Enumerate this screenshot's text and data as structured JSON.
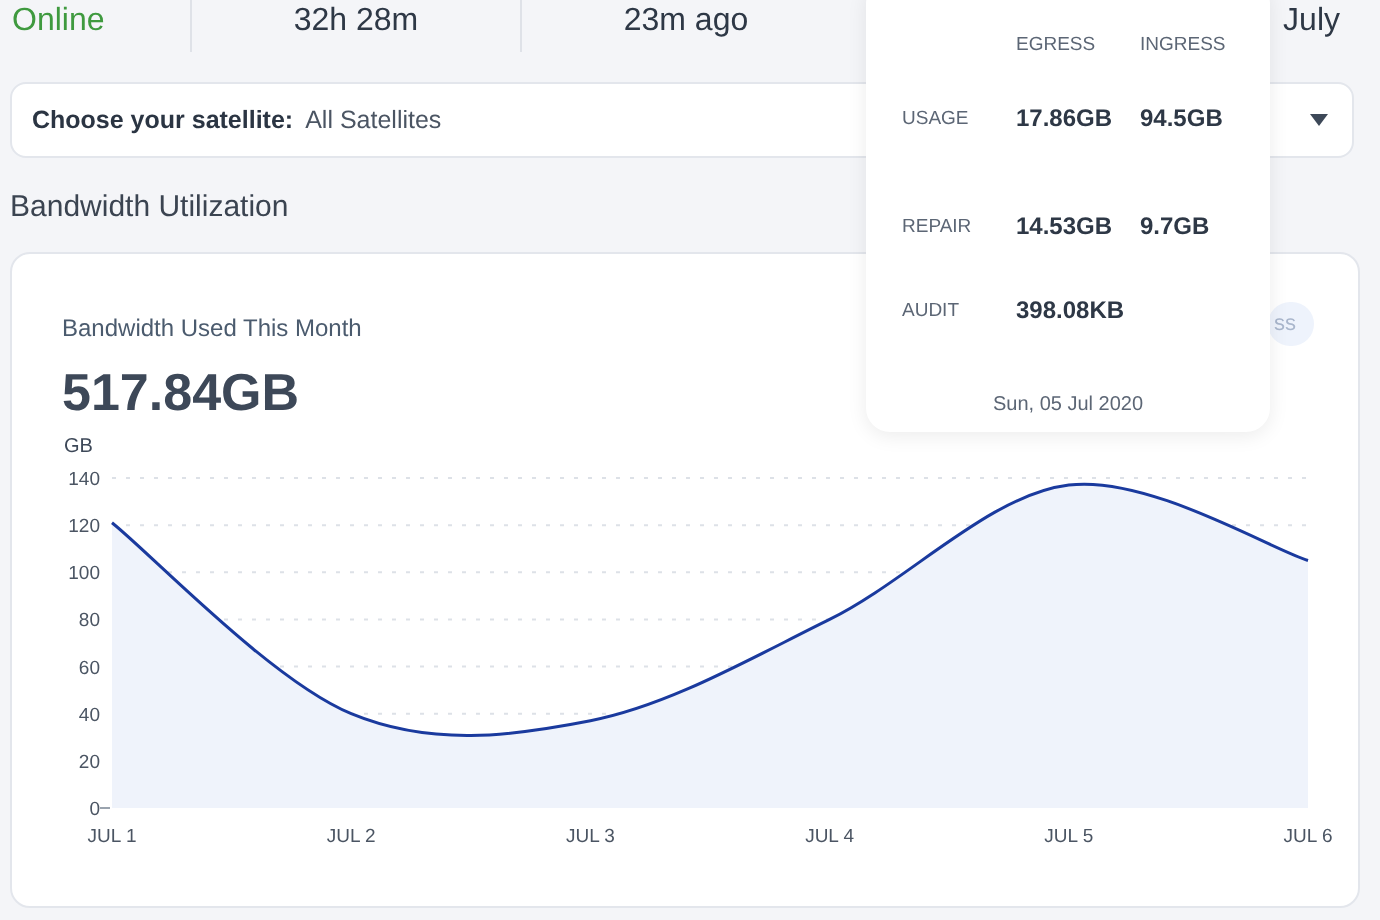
{
  "status_bar": {
    "items": [
      {
        "kind": "status",
        "text": "Online"
      },
      {
        "kind": "stat",
        "text": "32h 28m"
      },
      {
        "kind": "stat",
        "text": "23m ago"
      },
      {
        "kind": "month",
        "text": "July"
      }
    ]
  },
  "satellite_selector": {
    "label": "Choose your satellite:",
    "value": "All Satellites"
  },
  "section_title": "Bandwidth Utilization",
  "bandwidth_card": {
    "title": "Bandwidth Used This Month",
    "total": "517.84GB",
    "toggle_label": "ss",
    "chart_data": {
      "type": "area",
      "ylabel": "GB",
      "categories": [
        "JUL 1",
        "JUL 2",
        "JUL 3",
        "JUL 4",
        "JUL 5",
        "JUL 6"
      ],
      "series": [
        {
          "color": "#1a3a9e",
          "values": [
            121,
            40,
            37,
            80,
            137,
            105
          ]
        }
      ],
      "grid": true,
      "ylim": [
        0,
        140
      ],
      "yticks": [
        0,
        20,
        40,
        60,
        80,
        100,
        120,
        140
      ]
    }
  },
  "tooltip": {
    "columns": [
      "EGRESS",
      "INGRESS"
    ],
    "rows": [
      {
        "label": "USAGE",
        "values": [
          "17.86GB",
          "94.5GB"
        ]
      },
      {
        "label": "REPAIR",
        "values": [
          "14.53GB",
          "9.7GB"
        ]
      },
      {
        "label": "AUDIT",
        "values": [
          "398.08KB"
        ]
      }
    ],
    "date": "Sun, 05 Jul 2020"
  }
}
